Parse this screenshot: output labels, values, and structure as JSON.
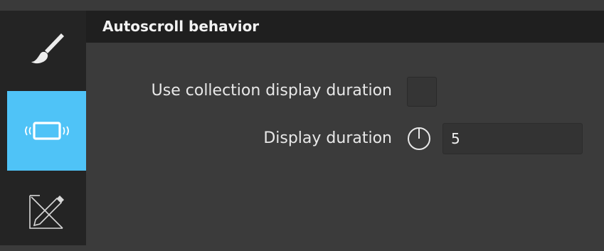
{
  "sidebar": {
    "items": [
      {
        "icon": "brush-icon",
        "active": false
      },
      {
        "icon": "autoscroll-icon",
        "active": true
      },
      {
        "icon": "edit-icon",
        "active": false
      }
    ],
    "accent_color": "#4fc3f7"
  },
  "section": {
    "title": "Autoscroll behavior"
  },
  "settings": {
    "use_collection_label": "Use collection display duration",
    "use_collection_checked": false,
    "display_duration_label": "Display duration",
    "display_duration_value": "5",
    "display_duration_icon": "clock-icon"
  }
}
